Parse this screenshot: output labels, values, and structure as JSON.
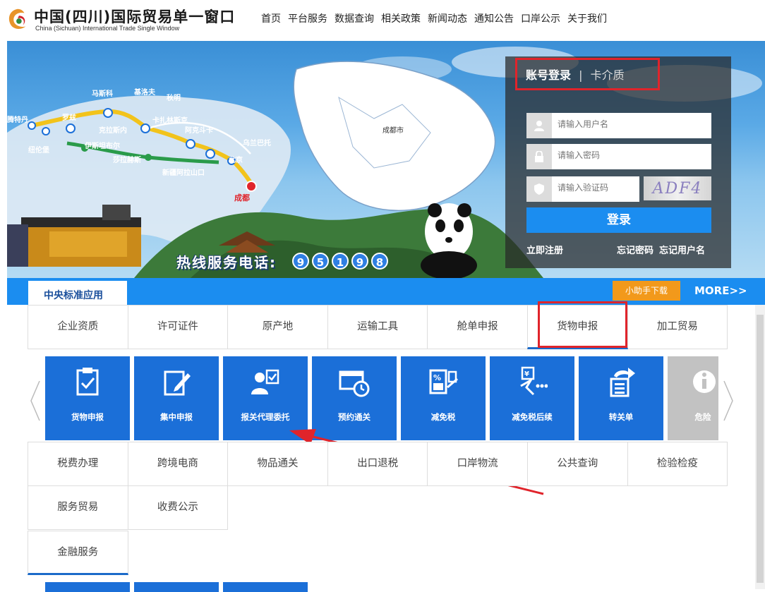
{
  "header": {
    "title": "中国(四川)国际贸易单一窗口",
    "subtitle": "China (Sichuan) International Trade Single Window",
    "nav": [
      "首页",
      "平台服务",
      "数据查询",
      "相关政策",
      "新闻动态",
      "通知公告",
      "口岸公示",
      "关于我们"
    ]
  },
  "banner": {
    "route_labels": [
      "马斯科",
      "基洛夫",
      "秋明",
      "克拉斯内",
      "卡扎林斯克",
      "阿克斗卡",
      "乌兰巴托",
      "罗兹",
      "伊斯坦布尔",
      "莎拉赫斯",
      "新疆阿拉山口",
      "北京",
      "成都",
      "腾特丹",
      "纽伦堡"
    ],
    "map_label": "成都市",
    "hotline_label": "热线服务电话:",
    "hotline_digits": [
      "9",
      "5",
      "1",
      "9",
      "8"
    ]
  },
  "login": {
    "tab_active": "账号登录",
    "tab_separator": "|",
    "tab_inactive": "卡介质",
    "username_placeholder": "请输入用户名",
    "password_placeholder": "请输入密码",
    "captcha_placeholder": "请输入验证码",
    "captcha_text": "ADF4",
    "login_button": "登录",
    "register": "立即注册",
    "forgot_password": "忘记密码",
    "forgot_username": "忘记用户名"
  },
  "apps": {
    "section_tab": "中央标准应用",
    "assistant_download": "小助手下载",
    "more": "MORE>>",
    "row1": [
      "企业资质",
      "许可证件",
      "原产地",
      "运输工具",
      "舱单申报",
      "货物申报",
      "加工贸易"
    ],
    "tiles": [
      "货物申报",
      "集中申报",
      "报关代理委托",
      "预约通关",
      "减免税",
      "减免税后续",
      "转关单",
      "危险"
    ],
    "row2": [
      "税费办理",
      "跨境电商",
      "物品通关",
      "出口退税",
      "口岸物流",
      "公共查询",
      "检验检疫"
    ],
    "row3": [
      "服务贸易",
      "收费公示"
    ],
    "row4": [
      "金融服务"
    ]
  },
  "colors": {
    "primary_blue": "#1b8df0",
    "tile_blue": "#1b6fd8",
    "highlight_red": "#e0242b",
    "assist_orange": "#f2991b"
  }
}
